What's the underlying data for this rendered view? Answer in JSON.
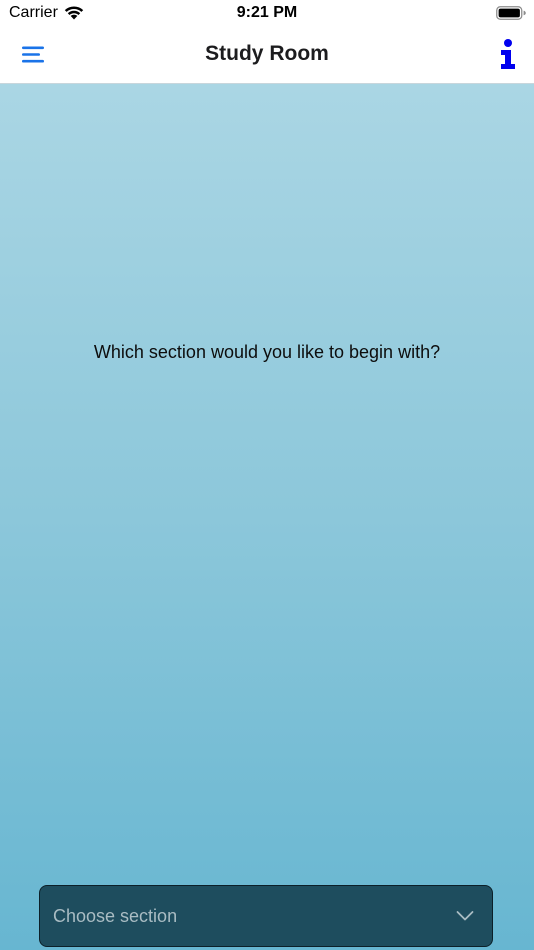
{
  "status_bar": {
    "carrier": "Carrier",
    "time": "9:21 PM"
  },
  "nav": {
    "title": "Study Room",
    "menu_icon": "hamburger-menu-icon",
    "info_icon": "info-icon"
  },
  "main": {
    "prompt": "Which section would you like to begin with?",
    "select": {
      "placeholder": "Choose section",
      "icon": "chevron-down-icon"
    }
  },
  "colors": {
    "accent": "#1a73e8",
    "info": "#0000ee",
    "select_bg": "#1e4d5e",
    "gradient_top": "#aad6e4",
    "gradient_bottom": "#67b6d1"
  }
}
